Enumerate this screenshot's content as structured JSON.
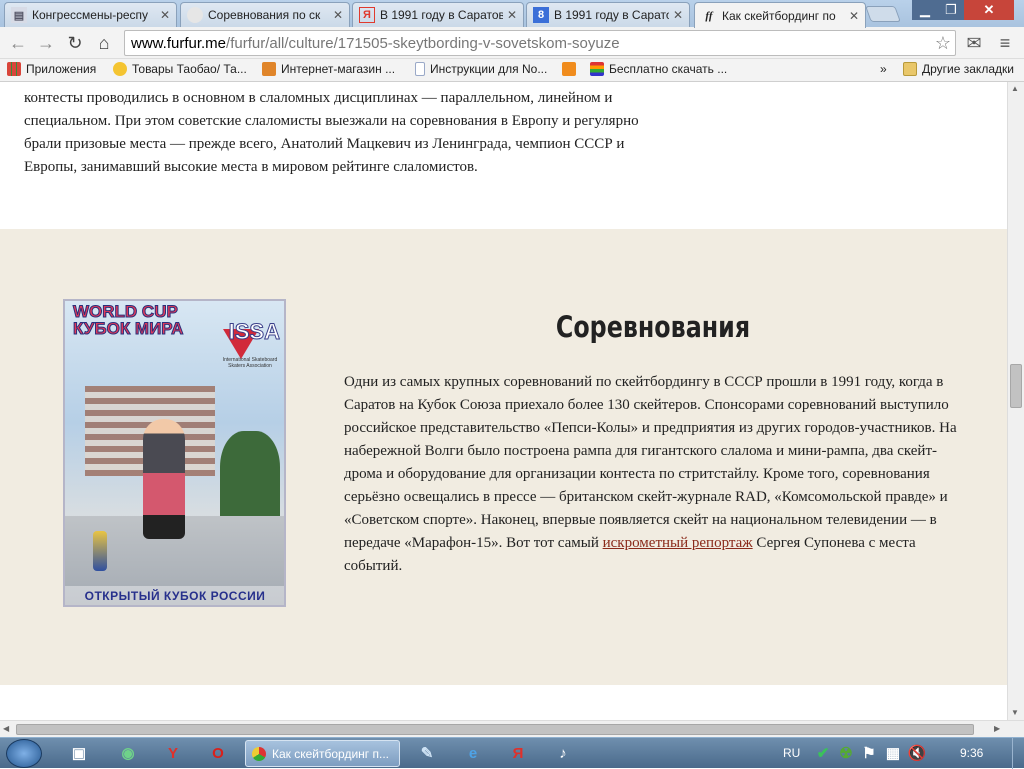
{
  "browser": {
    "tabs": [
      {
        "title": "Конгрессмены-респу",
        "favicon": "document-icon",
        "active": false
      },
      {
        "title": "Соревнования по ск",
        "favicon": "blank-icon",
        "active": false
      },
      {
        "title": "В 1991 году в Саратов",
        "favicon": "yandex-icon",
        "active": false
      },
      {
        "title": "В 1991 году в Сарато",
        "favicon": "google-icon",
        "active": false
      },
      {
        "title": "Как скейтбординг по",
        "favicon": "furfur-icon",
        "active": true
      }
    ],
    "url_host": "www.furfur.me",
    "url_path": "/furfur/all/culture/171505-skeytbording-v-sovetskom-soyuze",
    "bookmarks": [
      {
        "label": "Приложения",
        "icon": "apps-icon",
        "color": "#d9453a"
      },
      {
        "label": "Товары Таобао/ Та...",
        "icon": "taobao-icon",
        "color": "#f4c431"
      },
      {
        "label": "Интернет-магазин ...",
        "icon": "shop-icon",
        "color": "#e0852a"
      },
      {
        "label": "Инструкции для No...",
        "icon": "page-icon",
        "color": "#9aa9c8"
      },
      {
        "label": "",
        "icon": "odnoklassniki-icon",
        "color": "#f08c1d"
      },
      {
        "label": "Бесплатно скачать ...",
        "icon": "download-icon",
        "color": "#c03a8a"
      }
    ],
    "bookmarks_overflow": "»",
    "other_bookmarks": "Другие закладки"
  },
  "article": {
    "intro_text": "контесты проводились в основном в слаломных дисциплинах — параллельном, линейном и специальном. При этом советские слаломисты выезжали на соревнования в Европу и регулярно брали призовые места — прежде всего, Анатолий Мацкевич из Ленинграда, чемпион СССР и Европы, занимавший высокие места в мировом рейтинге слаломистов.",
    "section_heading": "Соревнования",
    "section_text_before_link": "Одни из самых крупных соревнований по скейтбордингу в СССР прошли в 1991 году, когда в Саратов на Кубок Союза приехало более 130 скейтеров. Спонсорами соревнований выступило российское представительство «Пепси-Колы» и предприятия из других городов-участников. На набережной Волги было построена рампа для гигантского слалома и мини-рампа, два скейт-дрома и оборудование для организации контеста по стритстайлу. Кроме того, соревнования серьёзно освещались в прессе — британском скейт-журнале RAD, «Комсомольской правде» и «Советском спорте». Наконец, впервые появляется скейт на национальном телевидении — в передаче «Марафон-15». Вот тот самый ",
    "section_link": "искрометный репортаж",
    "section_text_after_link": " Сергея Супонева с места событий.",
    "poster": {
      "line1": "WORLD CUP",
      "line2": "КУБОК МИРА",
      "issa": "ISSA",
      "issa_sub": "International Skateboard Skaters Association",
      "bottom": "ОТКРЫТЫЙ КУБОК РОССИИ",
      "bottom_big": "КУБОК"
    }
  },
  "taskbar": {
    "active_task": "Как скейтбординг п...",
    "lang": "RU",
    "time": "9:36"
  },
  "colors": {
    "accent_link": "#8a2a1a",
    "section_bg": "#f1ece1"
  }
}
